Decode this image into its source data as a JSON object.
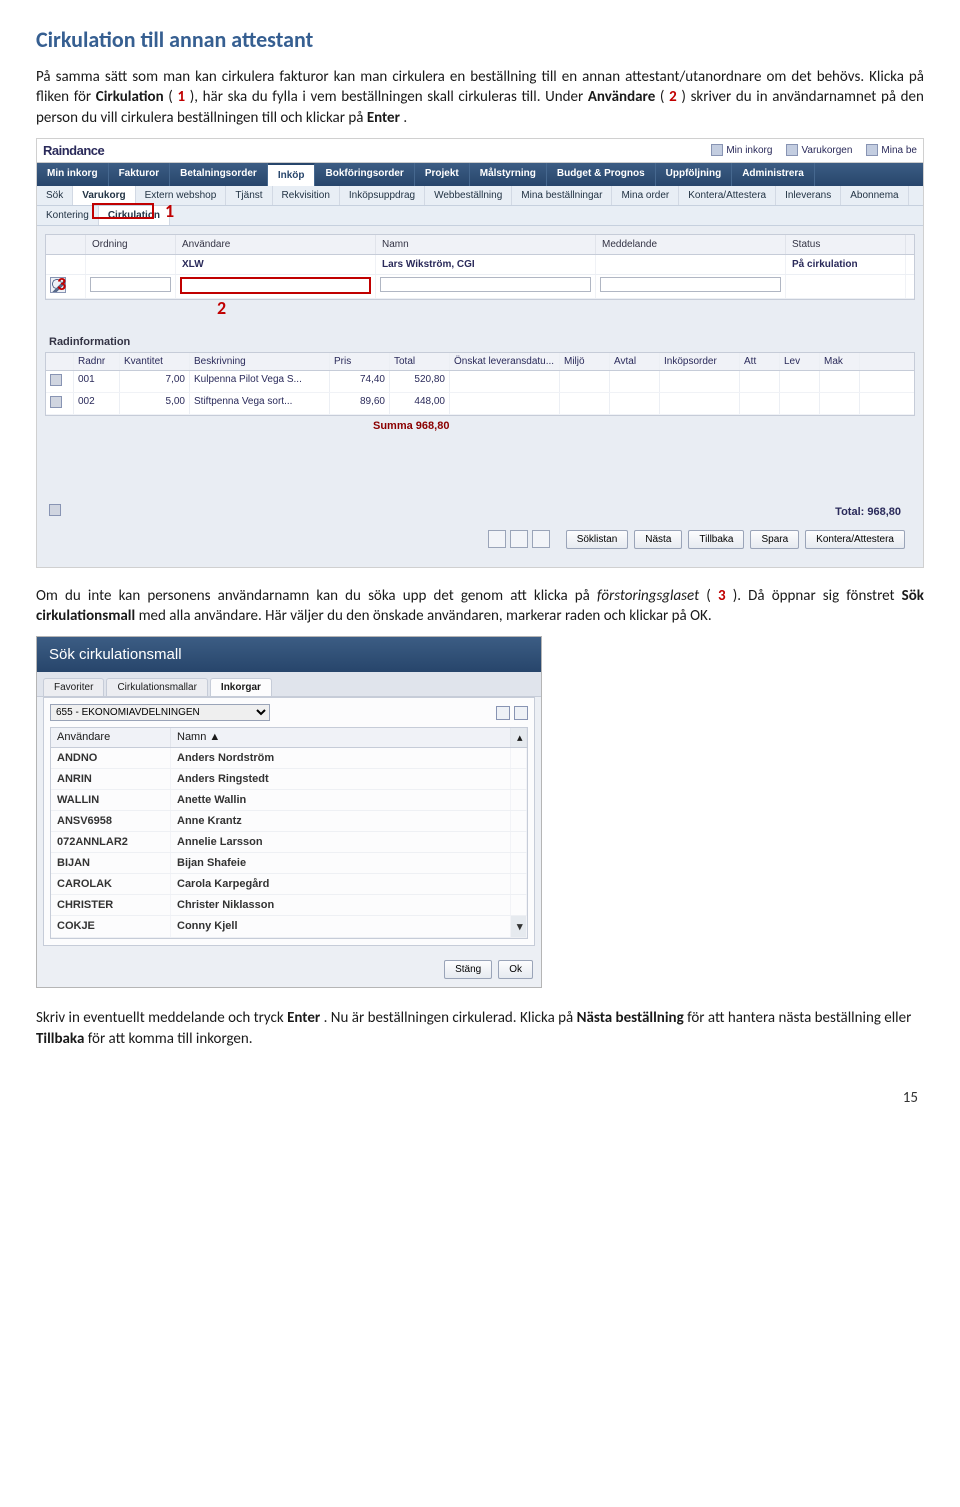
{
  "doc": {
    "title": "Cirkulation till annan attestant",
    "p1a": "På samma sätt som man kan cirkulera fakturor kan man cirkulera en beställning till en annan attestant/utanordnare om det behövs. Klicka på fliken för ",
    "p1b": "Cirkulation",
    "p1c": " (",
    "p1d": "1",
    "p1e": "), här ska du fylla i vem beställningen skall cirkuleras till. Under ",
    "p1f": "Användare",
    "p1g": " (",
    "p1h": "2",
    "p1i": ") skriver du in användarnamnet på den person du vill cirkulera beställningen till och klickar på ",
    "p1j": "Enter",
    "p1k": ".",
    "p2a": "Om du inte kan personens användarnamn kan du söka upp det genom att klicka på ",
    "p2b": "förstoringsglaset",
    "p2c": " (",
    "p2d": "3",
    "p2e": "). Då öppnar sig fönstret ",
    "p2f": "Sök cirkulationsmall",
    "p2g": " med alla användare. Här väljer du den önskade användaren, markerar raden och klickar på OK.",
    "p3a": "Skriv in eventuellt meddelande och tryck ",
    "p3b": "Enter",
    "p3c": ". Nu är beställningen cirkulerad. Klicka på ",
    "p3d": "Nästa beställning",
    "p3e": " för att hantera nästa beställning eller ",
    "p3f": "Tillbaka",
    "p3g": " för att komma till inkorgen.",
    "page_number": "15"
  },
  "rd": {
    "logo": "Raindance",
    "toplinks": [
      "Min inkorg",
      "Varukorgen",
      "Mina be"
    ],
    "mainnav": [
      "Min inkorg",
      "Fakturor",
      "Betalningsorder",
      "Inköp",
      "Bokföringsorder",
      "Projekt",
      "Målstyrning",
      "Budget & Prognos",
      "Uppföljning",
      "Administrera"
    ],
    "mainnav_active": "Inköp",
    "subnav": [
      "Sök",
      "Varukorg",
      "Extern webshop",
      "Tjänst",
      "Rekvisition",
      "Inköpsuppdrag",
      "Webbeställning",
      "Mina beställningar",
      "Mina order",
      "Kontera/Attestera",
      "Inleverans",
      "Abonnema"
    ],
    "subnav_active": "Varukorg",
    "subnav2": [
      "Kontering",
      "Cirkulation"
    ],
    "subnav2_active": "Cirkulation",
    "grid_head": [
      "",
      "Ordning",
      "Användare",
      "Namn",
      "Meddelande",
      "Status"
    ],
    "grid_row1": {
      "ordning": "",
      "anv": "XLW",
      "namn": "Lars Wikström, CGI",
      "medd": "",
      "status": "På cirkulation"
    },
    "radinfo_title": "Radinformation",
    "dhead": [
      "",
      "Radnr",
      "Kvantitet",
      "Beskrivning",
      "Pris",
      "Total",
      "Önskat leveransdatu...",
      "Miljö",
      "Avtal",
      "Inköpsorder",
      "Att",
      "Lev",
      "Mak"
    ],
    "drows": [
      {
        "radnr": "001",
        "kv": "7,00",
        "besk": "Kulpenna Pilot Vega S...",
        "pris": "74,40",
        "total": "520,80"
      },
      {
        "radnr": "002",
        "kv": "5,00",
        "besk": "Stiftpenna Vega sort...",
        "pris": "89,60",
        "total": "448,00"
      }
    ],
    "summa": "Summa 968,80",
    "total": "Total: 968,80",
    "actions": [
      "Söklistan",
      "Nästa",
      "Tillbaka",
      "Spara",
      "Kontera/Attestera"
    ],
    "annot1": "1",
    "annot2": "2",
    "annot3": "3"
  },
  "dlg": {
    "title": "Sök cirkulationsmall",
    "tabs": [
      "Favoriter",
      "Cirkulationsmallar",
      "Inkorgar"
    ],
    "tab_active": "Inkorgar",
    "select": "655 - EKONOMIAVDELNINGEN",
    "ghead": [
      "Användare",
      "Namn ▲"
    ],
    "rows": [
      {
        "a": "ANDNO",
        "n": "Anders Nordström"
      },
      {
        "a": "ANRIN",
        "n": "Anders Ringstedt"
      },
      {
        "a": "WALLIN",
        "n": "Anette Wallin"
      },
      {
        "a": "ANSV6958",
        "n": "Anne Krantz"
      },
      {
        "a": "072ANNLAR2",
        "n": "Annelie Larsson"
      },
      {
        "a": "BIJAN",
        "n": "Bijan Shafeie"
      },
      {
        "a": "CAROLAK",
        "n": "Carola Karpegård"
      },
      {
        "a": "CHRISTER",
        "n": "Christer Niklasson"
      },
      {
        "a": "COKJE",
        "n": "Conny Kjell"
      }
    ],
    "btn_close": "Stäng",
    "btn_ok": "Ok"
  }
}
